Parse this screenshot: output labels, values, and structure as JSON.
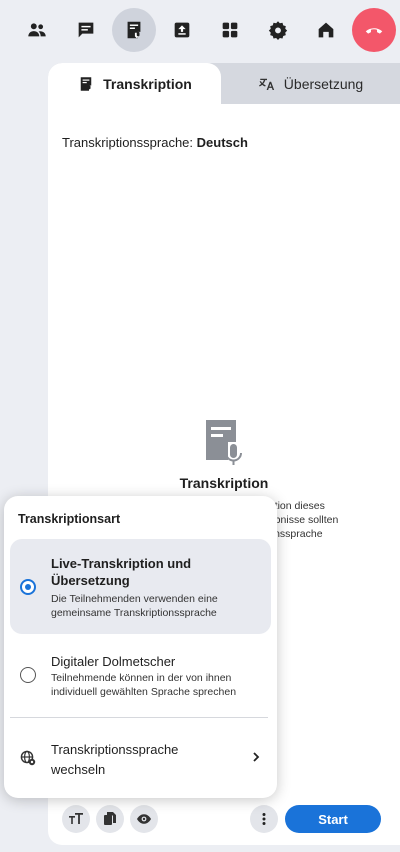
{
  "toolbar": {
    "items": [
      {
        "name": "participants",
        "icon": "people-icon"
      },
      {
        "name": "chat",
        "icon": "chat-icon"
      },
      {
        "name": "transcription",
        "icon": "transcript-icon",
        "active": true
      },
      {
        "name": "share",
        "icon": "upload-icon"
      },
      {
        "name": "apps",
        "icon": "apps-icon"
      },
      {
        "name": "settings",
        "icon": "gear-icon"
      },
      {
        "name": "home",
        "icon": "home-icon"
      },
      {
        "name": "hangup",
        "icon": "hangup-icon",
        "color": "#f3576a"
      }
    ]
  },
  "tabs": {
    "transcription": "Transkription",
    "translation": "Übersetzung"
  },
  "panel": {
    "language_label": "Transkriptionssprache:",
    "language_value": "Deutsch",
    "empty_title": "Transkription",
    "empty_text_lines": [
      "ription dieses",
      "gebnisse sollten",
      "tionssprache"
    ]
  },
  "popup": {
    "title": "Transkriptionsart",
    "option_live_title": "Live-Transkription und Übersetzung",
    "option_live_desc": "Die Teilnehmenden verwenden eine gemeinsame Transkriptionssprache",
    "option_live_selected": true,
    "option_interpreter_title": "Digitaler Dolmetscher",
    "option_interpreter_desc": "Teilnehmende können in der von ihnen individuell gewählten Sprache sprechen",
    "switch_language_label": "Transkriptionssprache wechseln"
  },
  "bottom_bar": {
    "start_label": "Start"
  },
  "colors": {
    "accent": "#1a73d9",
    "hangup": "#f3576a",
    "background": "#eceef3"
  }
}
